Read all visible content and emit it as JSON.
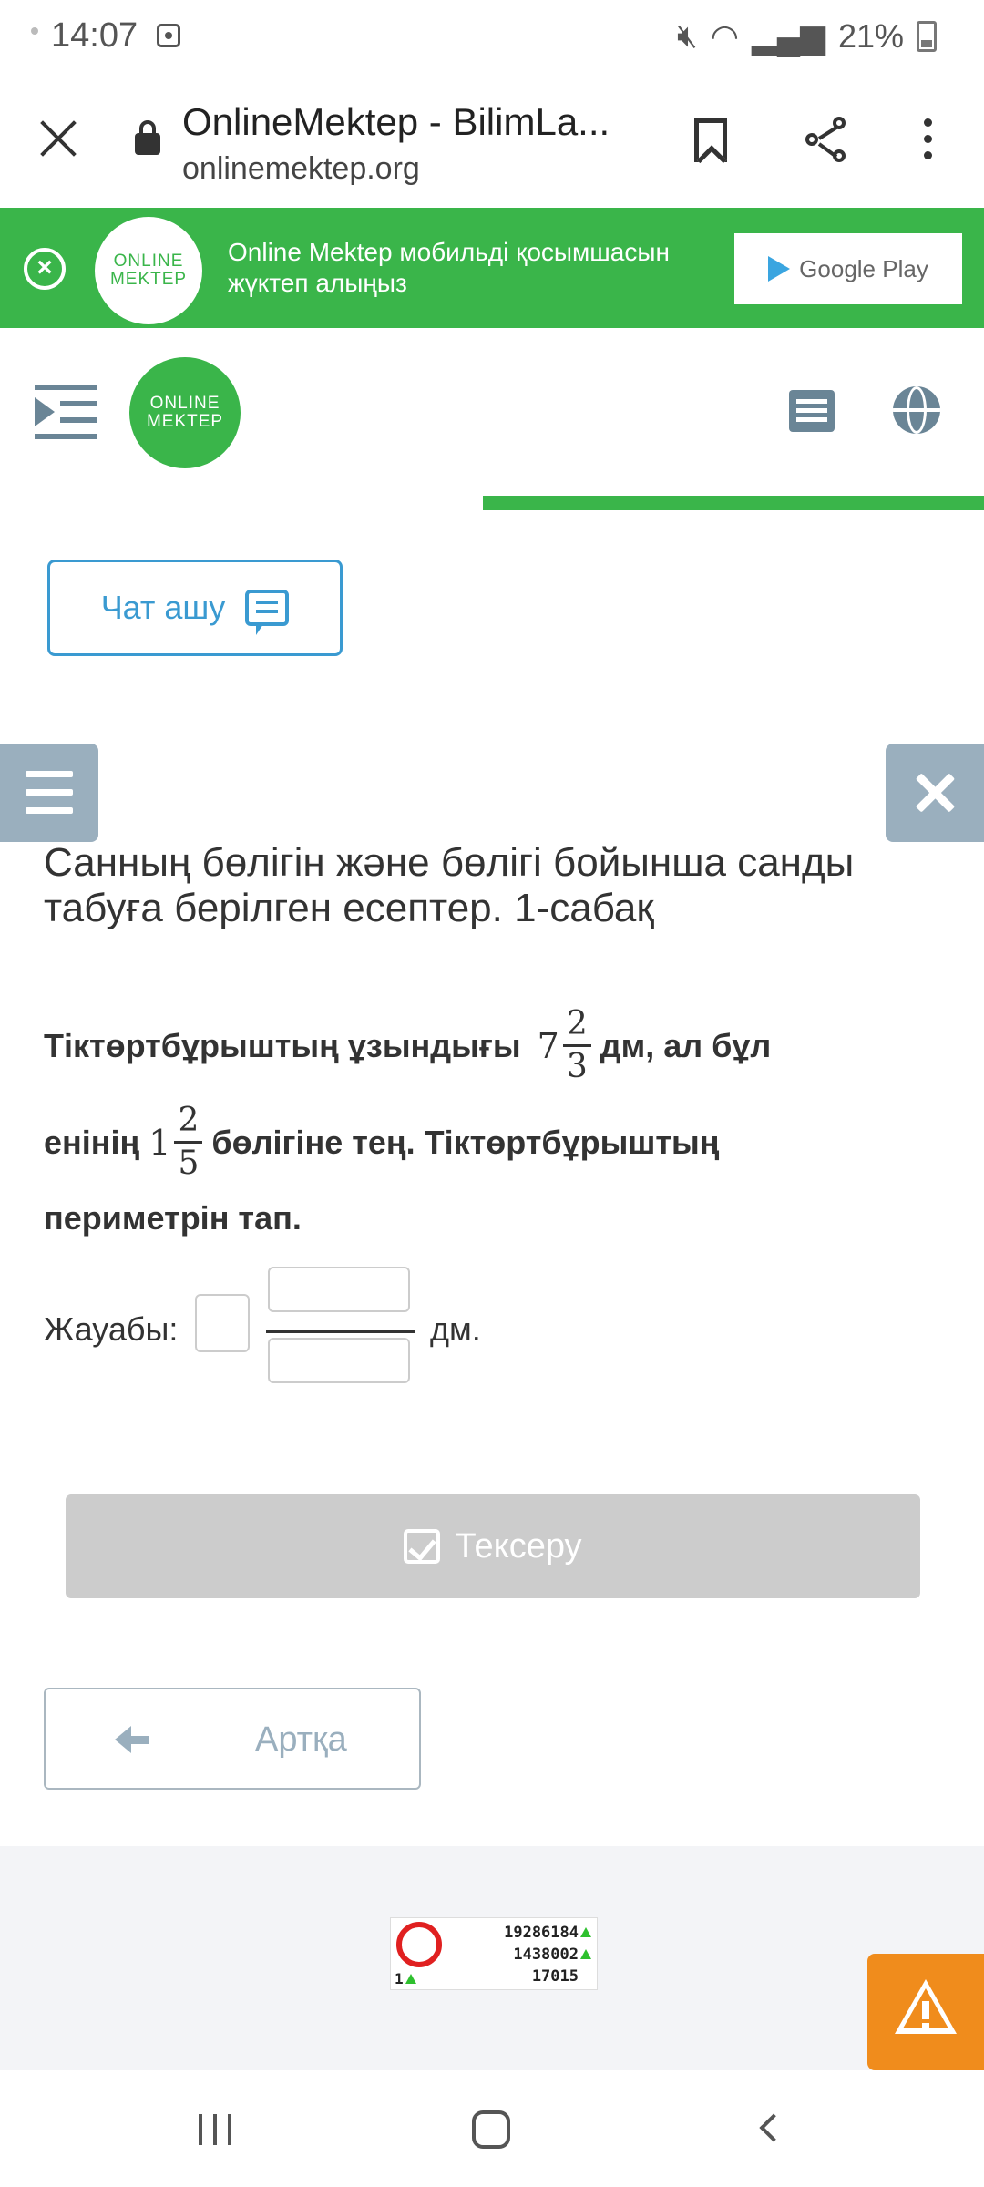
{
  "status_bar": {
    "time": "14:07",
    "battery": "21%"
  },
  "browser": {
    "title": "OnlineMektep - BilimLa...",
    "url": "onlinemektep.org"
  },
  "promo_banner": {
    "logo_line1": "ONLINE",
    "logo_line2": "MEKTEP",
    "text": "Online Mektep мобильді қосымшасын жүктеп алыңыз",
    "store_button": "Google Play",
    "background_color": "#3ab54a"
  },
  "header": {
    "logo_line1": "ONLINE",
    "logo_line2": "MEKTEP",
    "lesson_progress_fraction": 0.51
  },
  "chat_button": {
    "label": "Чат ашу"
  },
  "lesson": {
    "title": "Санның бөлігін және бөлігі бойынша санды табуға берілген есептер. 1-сабақ",
    "task": {
      "line1_text": "Тіктөртбұрыштың ұзындығы",
      "line1_after": "дм, ал бұл",
      "length_fraction": {
        "whole": "7",
        "numerator": "2",
        "denominator": "3"
      },
      "line2_before": "енінің",
      "part_fraction": {
        "whole": "1",
        "numerator": "2",
        "denominator": "5"
      },
      "line2_after": "бөлігіне тең. Тіктөртбұрыштың",
      "line3": "периметрін тап."
    },
    "answer": {
      "label": "Жауабы:",
      "unit": "дм.",
      "whole_value": "",
      "numerator_value": "",
      "denominator_value": ""
    },
    "check_button": "Тексеру",
    "back_button": "Артқа"
  },
  "counter_widget": {
    "rank": "1",
    "values": [
      "19286184",
      "1438002",
      "17015"
    ]
  },
  "icons": {
    "close": "close-icon",
    "lock": "lock-icon",
    "bookmark": "bookmark-icon",
    "share": "share-icon",
    "menu": "more-vert-icon",
    "chat": "chat-icon",
    "globe": "globe-icon",
    "alert": "warning-icon"
  },
  "colors": {
    "accent_green": "#3ab54a",
    "accent_blue": "#3a9ad1",
    "slate": "#9aafbe",
    "warning_orange": "#f08c1c"
  }
}
